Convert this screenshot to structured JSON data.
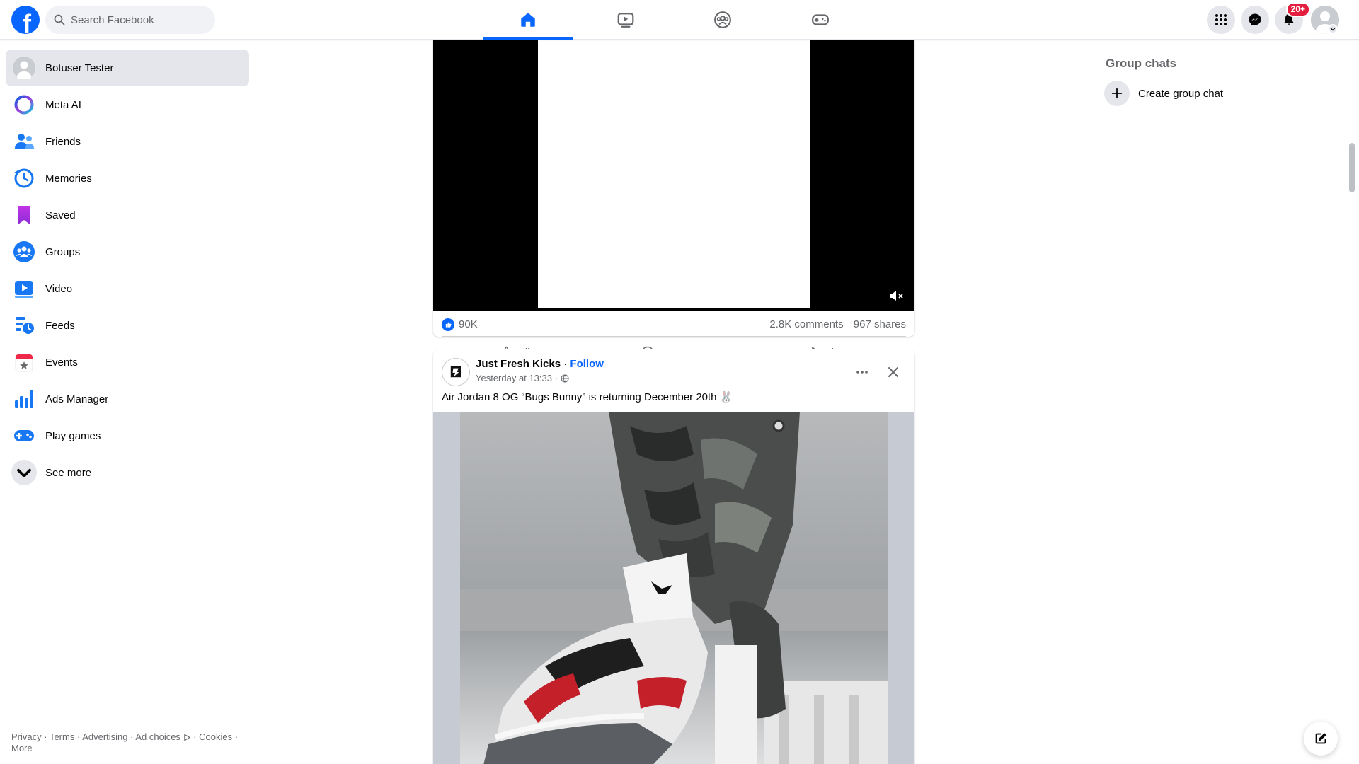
{
  "search": {
    "placeholder": "Search Facebook"
  },
  "nav": {
    "tabs": [
      {
        "name": "home",
        "icon": "home-icon",
        "active": true
      },
      {
        "name": "video",
        "icon": "video-icon",
        "active": false
      },
      {
        "name": "groups",
        "icon": "groups-icon",
        "active": false
      },
      {
        "name": "gaming",
        "icon": "gaming-icon",
        "active": false
      }
    ]
  },
  "top_right": {
    "notifications_badge": "20+"
  },
  "sidebar": {
    "items": [
      {
        "label": "Botuser Tester",
        "icon": "profile-avatar-icon"
      },
      {
        "label": "Meta AI",
        "icon": "meta-ai-icon"
      },
      {
        "label": "Friends",
        "icon": "friends-icon"
      },
      {
        "label": "Memories",
        "icon": "memories-icon"
      },
      {
        "label": "Saved",
        "icon": "saved-icon"
      },
      {
        "label": "Groups",
        "icon": "groups-icon"
      },
      {
        "label": "Video",
        "icon": "video-icon"
      },
      {
        "label": "Feeds",
        "icon": "feeds-icon"
      },
      {
        "label": "Events",
        "icon": "events-icon"
      },
      {
        "label": "Ads Manager",
        "icon": "ads-manager-icon"
      },
      {
        "label": "Play games",
        "icon": "play-games-icon"
      },
      {
        "label": "See more",
        "icon": "chevron-down-icon"
      }
    ]
  },
  "footer": {
    "privacy": "Privacy",
    "terms": "Terms",
    "advertising": "Advertising",
    "ad_choices": "Ad choices",
    "cookies": "Cookies",
    "more": "More",
    "dot": " · "
  },
  "post1": {
    "reactions": "90K",
    "comments": "2.8K comments",
    "shares": "967 shares",
    "like_label": "Like",
    "comment_label": "Comment",
    "share_label": "Share"
  },
  "post2": {
    "page_name": "Just Fresh Kicks",
    "dot": " · ",
    "follow_label": "Follow",
    "time": "Yesterday at 13:33 ·",
    "text": "Air Jordan 8 OG “Bugs Bunny” is returning December 20th 🐰"
  },
  "right": {
    "group_chats_title": "Group chats",
    "create_group_chat": "Create group chat"
  },
  "colors": {
    "brand": "#0866ff",
    "badge": "#e41e3f"
  }
}
